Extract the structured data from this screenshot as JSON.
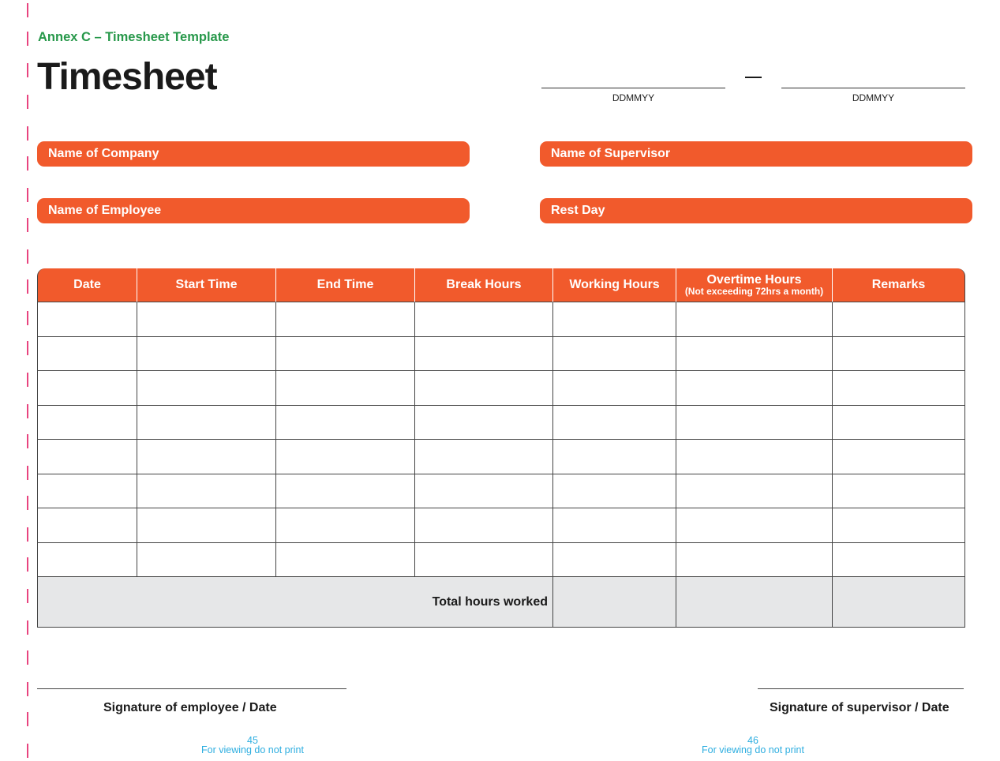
{
  "annex_label": "Annex C – Timesheet Template",
  "title": "Timesheet",
  "period": {
    "start_format": "DDMMYY",
    "end_format": "DDMMYY"
  },
  "fields": {
    "company": "Name of Company",
    "supervisor": "Name of Supervisor",
    "employee": "Name of Employee",
    "rest_day": "Rest Day"
  },
  "table": {
    "headers": {
      "date": "Date",
      "start_time": "Start Time",
      "end_time": "End Time",
      "break_hours": "Break Hours",
      "working_hours": "Working Hours",
      "overtime_hours": "Overtime Hours",
      "overtime_note": "(Not exceeding 72hrs a month)",
      "remarks": "Remarks"
    },
    "total_label": "Total hours worked"
  },
  "signatures": {
    "employee": "Signature of employee / Date",
    "supervisor": "Signature of supervisor / Date"
  },
  "footer": {
    "left_page": "45",
    "right_page": "46",
    "note": "For viewing do not print"
  },
  "colors": {
    "accent_orange": "#f15a2c",
    "annex_green": "#27984a",
    "margin_pink": "#e8447f",
    "footer_blue": "#2eaee0",
    "total_row_gray": "#e6e7e8"
  }
}
